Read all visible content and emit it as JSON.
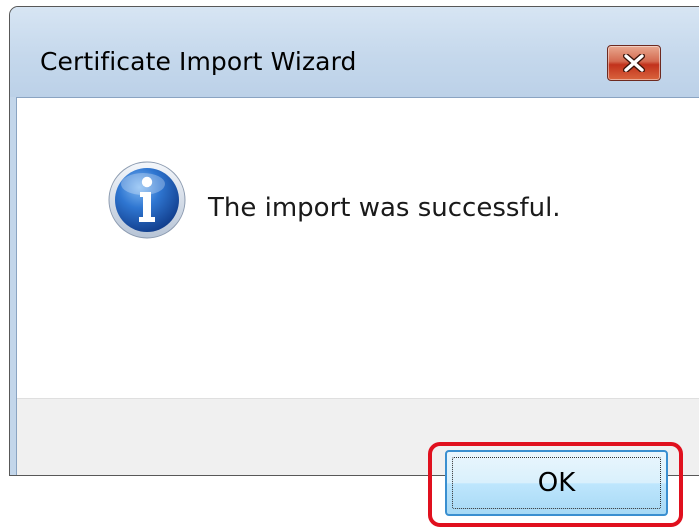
{
  "window": {
    "title": "Certificate Import Wizard",
    "close_icon": "close-x-icon"
  },
  "dialog": {
    "icon": "information-icon",
    "message": "The import was successful."
  },
  "buttons": {
    "ok_label": "OK"
  },
  "colors": {
    "highlight": "#e0101e",
    "close_button": "#c2321c",
    "ok_button_border": "#3a8fd0",
    "info_icon": "#1c5bb5"
  }
}
